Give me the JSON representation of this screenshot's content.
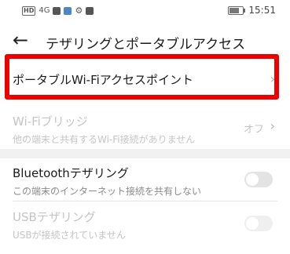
{
  "status_bar": {
    "network": "HD",
    "signal": "4G",
    "time": "15:51",
    "icons": [
      "hd-icon",
      "signal-icon",
      "app-icon",
      "settings-icon",
      "notification-icon",
      "battery-icon"
    ]
  },
  "header": {
    "title": "テザリングとポータブルアクセス"
  },
  "items": [
    {
      "title": "ポータブルWi-Fiアクセスポイント",
      "enabled": true,
      "highlighted": true
    },
    {
      "title": "Wi-Fiブリッジ",
      "subtitle": "他の端末と共有するWi-Fi接続がありません",
      "value": "オフ",
      "enabled": false
    },
    {
      "title": "Bluetoothテザリング",
      "subtitle": "この端末のインターネット接続を共有しない",
      "toggle": false,
      "enabled": true
    },
    {
      "title": "USBテザリング",
      "subtitle": "USBが接続されていません",
      "toggle": false,
      "enabled": false
    }
  ],
  "colors": {
    "highlight": "#e00000",
    "background": "#ffffff",
    "divider": "#f1f1f1"
  }
}
